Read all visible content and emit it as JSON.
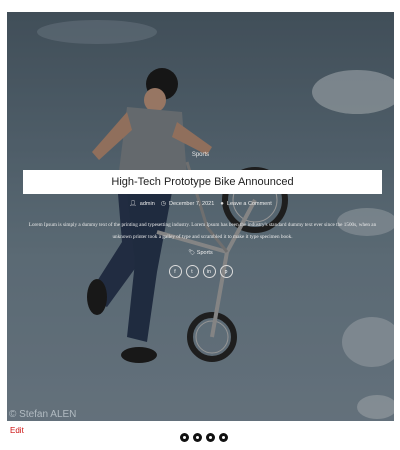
{
  "post": {
    "category": "Sports",
    "title": "High-Tech Prototype Bike Announced",
    "author": "admin",
    "date": "December 7, 2021",
    "comments": "Leave a Comment",
    "excerpt": "Lorem Ipsum is simply a dummy text of the printing and typesetting industry. Lorem Ipsum has been the industry's standard dummy text ever since the 1500s, when an unknown printer took a galley of type and scrambled it to make it type specimen book.",
    "tags": "Sports",
    "photo_credit": "© Stefan ALEN",
    "photo_subject": "bmx-rider-midair"
  },
  "share": [
    {
      "icon": "facebook-icon",
      "glyph": "f"
    },
    {
      "icon": "twitter-icon",
      "glyph": "t"
    },
    {
      "icon": "linkedin-icon",
      "glyph": "in"
    },
    {
      "icon": "pinterest-icon",
      "glyph": "p"
    }
  ],
  "edit_link": "Edit",
  "slider": {
    "dots": 4,
    "active_index": 0
  },
  "colors": {
    "edit_link": "#cc1111",
    "title_bg": "#ffffff",
    "dot": "#111111"
  }
}
